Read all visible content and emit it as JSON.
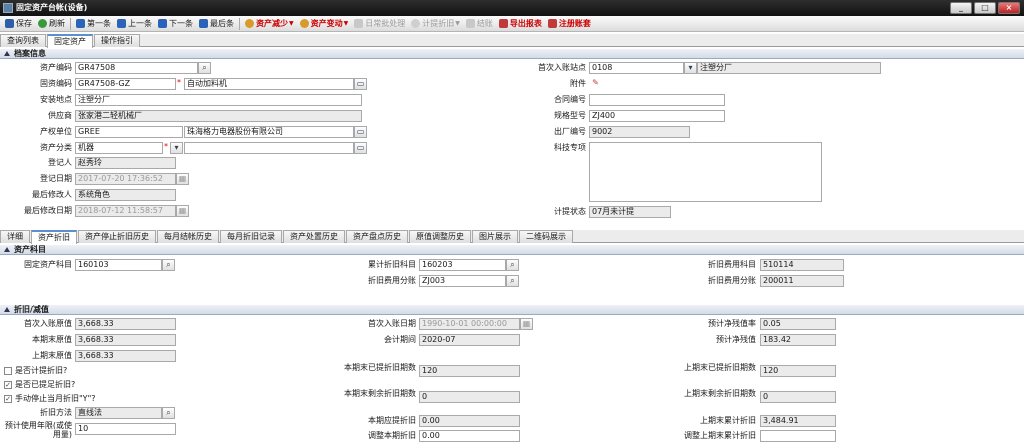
{
  "window": {
    "title": "固定资产台帐(设备)",
    "buttons": [
      "_",
      "□",
      "×"
    ]
  },
  "toolbar": {
    "save": "保存",
    "refresh": "刷新",
    "first": "第一条",
    "prev": "上一条",
    "next": "下一条",
    "last": "最后条",
    "decrease": "资产减少",
    "change": "资产变动",
    "daily": "日常批处理",
    "depreciate": "计提折旧",
    "settle": "结账",
    "export": "导出报表",
    "cancel_account": "注册账套"
  },
  "top_tabs": [
    "查询列表",
    "固定资产",
    "操作指引"
  ],
  "archive": {
    "header": "档案信息",
    "asset_code_label": "资产编码",
    "asset_code": "GR47508",
    "fixed_code_label": "固资编码",
    "fixed_code": "GR47508-GZ",
    "fixed_name": "自动加料机",
    "location_label": "安装地点",
    "location": "注塑分厂",
    "supplier_label": "供应商",
    "supplier": "张家港二轻机械厂",
    "owner_label": "产权单位",
    "owner_code": "GREE",
    "owner_name": "珠海格力电器股份有限公司",
    "category_label": "资产分类",
    "category": "机器",
    "registrar_label": "登记人",
    "registrar": "赵秀玲",
    "reg_date_label": "登记日期",
    "reg_date": "2017-07-20 17:36:52",
    "modifier_label": "最后修改人",
    "modifier": "系统角色",
    "mod_date_label": "最后修改日期",
    "mod_date": "2018-07-12 11:58:57",
    "site_label": "首次入账站点",
    "site_code": "0108",
    "site_name": "注塑分厂",
    "attach_label": "附件",
    "contract_label": "合同编号",
    "contract": "",
    "model_label": "规格型号",
    "model": "ZJ400",
    "factory_no_label": "出厂编号",
    "factory_no": "9002",
    "tech_label": "科技专项",
    "tech": "",
    "status_label": "计提状态",
    "status": "07月未计提"
  },
  "sub_tabs": [
    "详细",
    "资产折旧",
    "资产停止折旧历史",
    "每月结帐历史",
    "每月折旧记录",
    "资产处置历史",
    "资产盘点历史",
    "原值调整历史",
    "图片展示",
    "二维码展示"
  ],
  "subject": {
    "header": "资产科目",
    "fixed_subject_label": "固定资产科目",
    "fixed_subject": "160103",
    "accum_label": "累计折旧科目",
    "accum": "160203",
    "dep_split_label": "折旧费用分账",
    "dep_split": "ZJ003",
    "exp_subject_label": "折旧费用科目",
    "exp_subject": "510114",
    "exp_split_label": "折旧费用分账",
    "exp_split": "200011"
  },
  "depreciation": {
    "header": "折旧/减值",
    "first_value_label": "首次入账原值",
    "first_value": "3,668.33",
    "end_value_label": "本期末原值",
    "end_value": "3,668.33",
    "prev_value_label": "上期末原值",
    "prev_value": "3,668.33",
    "chk_no_dep": "是否计提折旧?",
    "chk_has_dep": "是否已提足折旧?",
    "chk_manual": "手动停止当月折旧\"Y\"?",
    "method_label": "折旧方法",
    "method": "直线法",
    "life_label": "预计使用年限(或使用量)",
    "life": "10",
    "first_date_label": "首次入账日期",
    "first_date": "1990-10-01 00:00:00",
    "period_label": "会计期间",
    "period": "2020-07",
    "end_months_label": "本期末已提折旧期数",
    "end_months": "120",
    "end_remain_label": "本期末剩余折旧期数",
    "end_remain": "0",
    "cur_dep_label": "本期应提折旧",
    "cur_dep": "0.00",
    "adj_dep_label": "调整本期折旧",
    "adj_dep": "0.00",
    "salvage_rate_label": "预计净残值率",
    "salvage_rate": "0.05",
    "salvage_label": "预计净残值",
    "salvage": "183.42",
    "prev_months_label": "上期末已提折旧期数",
    "prev_months": "120",
    "prev_remain_label": "上期末剩余折旧期数",
    "prev_remain": "0",
    "prev_accum_label": "上期末累计折旧",
    "prev_accum": "3,484.91",
    "adj_prev_label": "调整上期末累计折旧",
    "adj_prev": ""
  }
}
